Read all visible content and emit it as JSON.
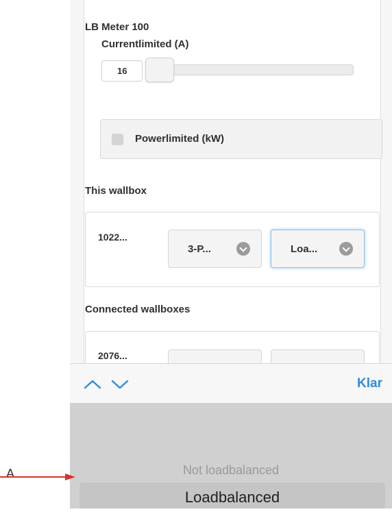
{
  "meter": {
    "title": "LB Meter 100",
    "current_label": "Currentlimited (A)",
    "current_value": "16",
    "power_label": "Powerlimited (kW)"
  },
  "this_wallbox": {
    "title": "This wallbox",
    "id": "1022...",
    "phase_select": "3-P...",
    "mode_select": "Loa..."
  },
  "connected_wallboxes": {
    "title": "Connected wallboxes",
    "id": "2076..."
  },
  "toolbar": {
    "done_label": "Klar",
    "up_icon": "chevron-up-icon",
    "down_icon": "chevron-down-icon"
  },
  "picker": {
    "options": [
      "Not loadbalanced",
      "Loadbalanced"
    ],
    "selected": "Loadbalanced"
  },
  "annotation": {
    "label": "A"
  },
  "colors": {
    "accent": "#2f8cdd",
    "annotation_arrow": "#d8322a"
  }
}
